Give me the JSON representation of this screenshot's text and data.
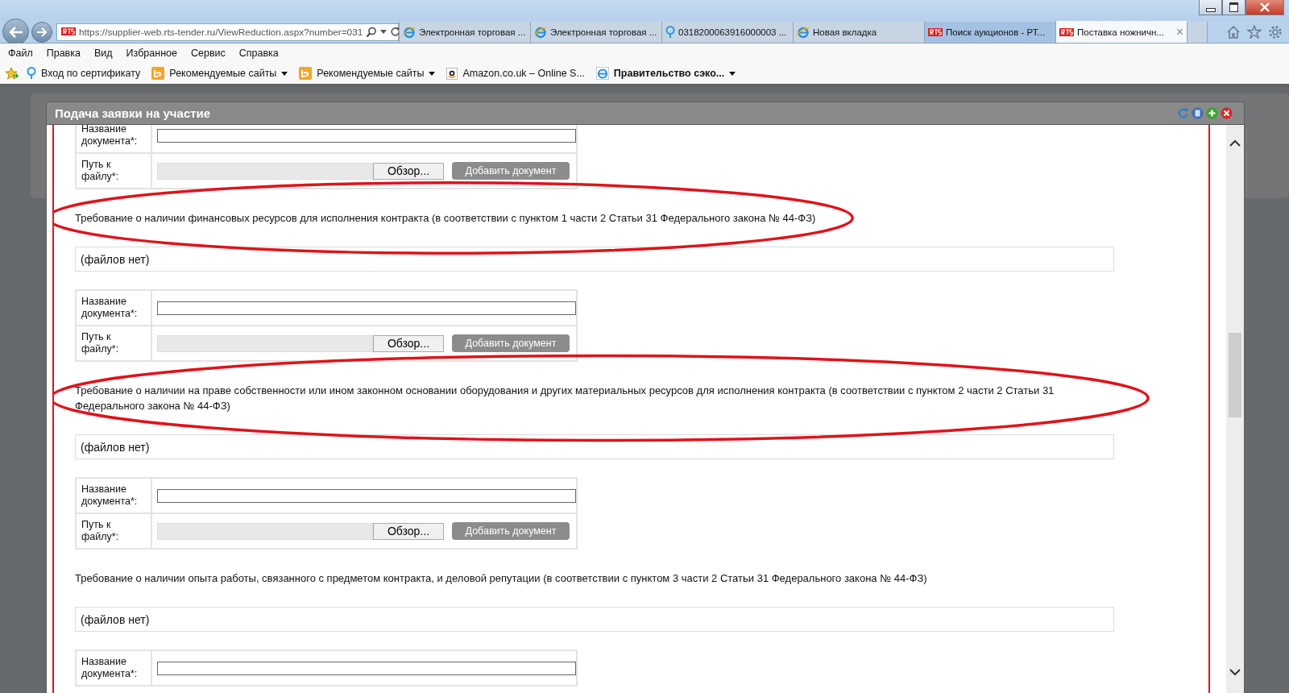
{
  "browser": {
    "address": "https://supplier-web.rts-tender.ru/ViewReduction.aspx?number=031",
    "tabs": [
      {
        "label": "Электронная торговая ...",
        "kind": "ie",
        "selected": false
      },
      {
        "label": "Электронная торговая ...",
        "kind": "ie",
        "selected": false
      },
      {
        "label": "0318200063916000003 ...",
        "kind": "bulb",
        "selected": false
      },
      {
        "label": "Новая вкладка",
        "kind": "ie",
        "selected": false
      },
      {
        "label": "Поиск аукционов - РТ...",
        "kind": "rts",
        "selected": false
      },
      {
        "label": "Поставка ножничн...",
        "kind": "rts",
        "selected": true
      }
    ],
    "close_tab": "×",
    "menu": [
      "Файл",
      "Правка",
      "Вид",
      "Избранное",
      "Сервис",
      "Справка"
    ],
    "favorites": [
      {
        "label": "Вход по сертификату",
        "kind": "bulb",
        "dropdown": false,
        "bold": false
      },
      {
        "label": "Рекомендуемые сайты",
        "kind": "bing",
        "dropdown": true,
        "bold": false
      },
      {
        "label": "Рекомендуемые сайты",
        "kind": "bing",
        "dropdown": true,
        "bold": false
      },
      {
        "label": "Amazon.co.uk – Online S...",
        "kind": "amazon",
        "dropdown": false,
        "bold": false
      },
      {
        "label": "Правительство сэко...",
        "kind": "ie",
        "dropdown": true,
        "bold": true
      }
    ]
  },
  "dialog": {
    "title": "Подача заявки на участие",
    "sections": [
      {
        "kind": "form",
        "name_label": "Название документа*:",
        "path_label": "Путь к файлу*:",
        "browse": "Обзор...",
        "add": "Добавить документ"
      },
      {
        "kind": "requirement",
        "text": "Требование о наличии финансовых ресурсов для исполнения контракта (в соответствии с пунктом 1 части 2 Статьи 31 Федерального закона № 44-ФЗ)",
        "highlighted": true
      },
      {
        "kind": "files",
        "text": "(файлов нет)"
      },
      {
        "kind": "form",
        "name_label": "Название документа*:",
        "path_label": "Путь к файлу*:",
        "browse": "Обзор...",
        "add": "Добавить документ"
      },
      {
        "kind": "requirement",
        "text": "Требование о наличии на праве собственности или ином законном основании оборудования и других материальных ресурсов для исполнения контракта (в соответствии с пунктом 2 части 2 Статьи 31 Федерального закона № 44-ФЗ)",
        "highlighted": true
      },
      {
        "kind": "files",
        "text": "(файлов нет)"
      },
      {
        "kind": "form",
        "name_label": "Название документа*:",
        "path_label": "Путь к файлу*:",
        "browse": "Обзор...",
        "add": "Добавить документ"
      },
      {
        "kind": "requirement",
        "text": "Требование о наличии опыта работы, связанного с предметом контракта, и деловой репутации (в соответствии с пунктом 3 части 2 Статьи 31 Федерального закона № 44-ФЗ)",
        "highlighted": false
      },
      {
        "kind": "files",
        "text": "(файлов нет)"
      },
      {
        "kind": "form",
        "name_label": "Название документа*:"
      }
    ]
  }
}
